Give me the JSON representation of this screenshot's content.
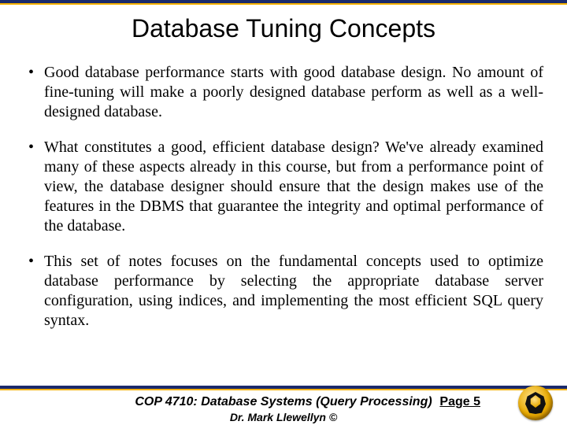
{
  "title": "Database Tuning Concepts",
  "bullets": [
    "Good database performance starts with good database design.  No amount of fine-tuning will make a poorly designed database perform as well as a well-designed database.",
    "What constitutes a good, efficient database design?   We've already examined many of these aspects already in this course, but from a performance point of view, the database designer should ensure that the design makes use of the features in the DBMS that guarantee the integrity and optimal performance of the database.",
    "This set of notes focuses on the fundamental concepts used to optimize database performance by selecting the appropriate database server configuration, using indices, and implementing the most efficient SQL query syntax."
  ],
  "footer": {
    "course": "COP 4710: Database Systems (Query Processing)",
    "author": "Dr. Mark Llewellyn ©",
    "page_label": "Page 5"
  },
  "logo_name": "ucf-pegasus-seal"
}
